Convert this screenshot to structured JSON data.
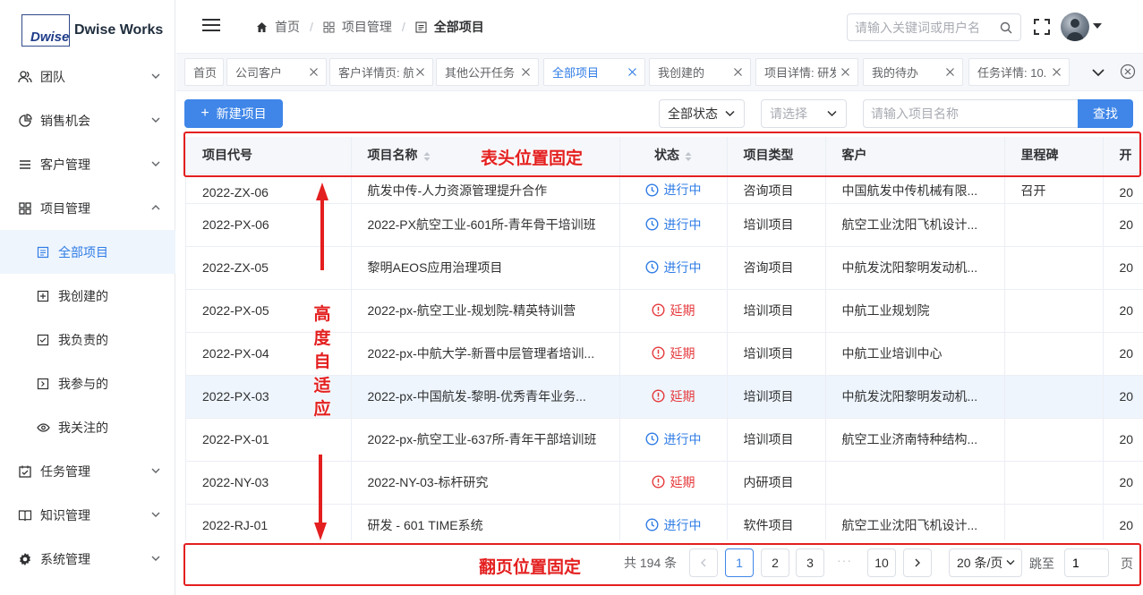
{
  "logo": {
    "mark": "Dwise",
    "name": "Dwise Works"
  },
  "sidebar": {
    "items": [
      {
        "label": "团队",
        "icon": "team-icon",
        "expandable": true
      },
      {
        "label": "销售机会",
        "icon": "pie-chart-icon",
        "expandable": true
      },
      {
        "label": "客户管理",
        "icon": "list-icon",
        "expandable": true
      },
      {
        "label": "项目管理",
        "icon": "grid-icon",
        "expandable": true,
        "expanded": true
      }
    ],
    "project_sub": [
      {
        "label": "全部项目",
        "icon": "document-icon",
        "active": true
      },
      {
        "label": "我创建的",
        "icon": "plus-square-icon"
      },
      {
        "label": "我负责的",
        "icon": "check-square-icon"
      },
      {
        "label": "我参与的",
        "icon": "arrow-square-icon"
      },
      {
        "label": "我关注的",
        "icon": "eye-icon"
      }
    ],
    "bottom_items": [
      {
        "label": "任务管理",
        "icon": "task-icon",
        "expandable": true
      },
      {
        "label": "知识管理",
        "icon": "book-icon",
        "expandable": true
      },
      {
        "label": "系统管理",
        "icon": "gear-icon",
        "expandable": true
      }
    ]
  },
  "header": {
    "breadcrumb": {
      "home": "首页",
      "parent": "项目管理",
      "current": "全部项目"
    },
    "search_placeholder": "请输入关键词或用户名"
  },
  "tabs": [
    {
      "label": "首页",
      "closable": false
    },
    {
      "label": "公司客户",
      "closable": true
    },
    {
      "label": "客户详情页: 航",
      "closable": true
    },
    {
      "label": "其他公开任务",
      "closable": true
    },
    {
      "label": "全部项目",
      "closable": true,
      "active": true
    },
    {
      "label": "我创建的",
      "closable": true
    },
    {
      "label": "项目详情: 研发",
      "closable": true
    },
    {
      "label": "我的待办",
      "closable": true
    },
    {
      "label": "任务详情: 10.",
      "closable": true
    }
  ],
  "toolbar": {
    "new_label": "新建项目",
    "status_select": "全部状态",
    "type_placeholder": "请选择",
    "name_placeholder": "请输入项目名称",
    "find_label": "查找"
  },
  "table": {
    "columns": [
      "项目代号",
      "项目名称",
      "状态",
      "项目类型",
      "客户",
      "里程碑",
      "开"
    ],
    "rows": [
      {
        "code": "2022-ZX-06",
        "name": "航发中传-人力资源管理提升合作",
        "status": "进行中",
        "status_kind": "running",
        "type": "咨询项目",
        "customer": "中国航发中传机械有限...",
        "milestone": "召开",
        "start": "20"
      },
      {
        "code": "2022-PX-06",
        "name": "2022-PX航空工业-601所-青年骨干培训班",
        "status": "进行中",
        "status_kind": "running",
        "type": "培训项目",
        "customer": "航空工业沈阳飞机设计...",
        "milestone": "",
        "start": "20"
      },
      {
        "code": "2022-ZX-05",
        "name": "黎明AEOS应用治理项目",
        "status": "进行中",
        "status_kind": "running",
        "type": "咨询项目",
        "customer": "中航发沈阳黎明发动机...",
        "milestone": "",
        "start": "20"
      },
      {
        "code": "2022-PX-05",
        "name": "2022-px-航空工业-规划院-精英特训营",
        "status": "延期",
        "status_kind": "delayed",
        "type": "培训项目",
        "customer": "中航工业规划院",
        "milestone": "",
        "start": "20"
      },
      {
        "code": "2022-PX-04",
        "name": "2022-px-中航大学-新晋中层管理者培训...",
        "status": "延期",
        "status_kind": "delayed",
        "type": "培训项目",
        "customer": "中航工业培训中心",
        "milestone": "",
        "start": "20"
      },
      {
        "code": "2022-PX-03",
        "name": "2022-px-中国航发-黎明-优秀青年业务...",
        "status": "延期",
        "status_kind": "delayed",
        "type": "培训项目",
        "customer": "中航发沈阳黎明发动机...",
        "milestone": "",
        "start": "20"
      },
      {
        "code": "2022-PX-01",
        "name": "2022-px-航空工业-637所-青年干部培训班",
        "status": "进行中",
        "status_kind": "running",
        "type": "培训项目",
        "customer": "航空工业济南特种结构...",
        "milestone": "",
        "start": "20"
      },
      {
        "code": "2022-NY-03",
        "name": "2022-NY-03-标杆研究",
        "status": "延期",
        "status_kind": "delayed",
        "type": "内研项目",
        "customer": "",
        "milestone": "",
        "start": "20"
      },
      {
        "code": "2022-RJ-01",
        "name": "研发 - 601 TIME系统",
        "status": "进行中",
        "status_kind": "running",
        "type": "软件项目",
        "customer": "航空工业沈阳飞机设计...",
        "milestone": "",
        "start": "20"
      }
    ]
  },
  "pagination": {
    "total_text": "共 194 条",
    "pages": [
      "1",
      "2",
      "3"
    ],
    "last_page": "10",
    "current": "1",
    "page_size": "20 条/页",
    "goto_label": "跳至",
    "goto_value": "1",
    "page_suffix": "页"
  },
  "annotations": {
    "header_fixed": "表头位置固定",
    "auto_height": [
      "高",
      "度",
      "自",
      "适",
      "应"
    ],
    "pager_fixed": "翻页位置固定",
    "color": "#e41f1f"
  }
}
